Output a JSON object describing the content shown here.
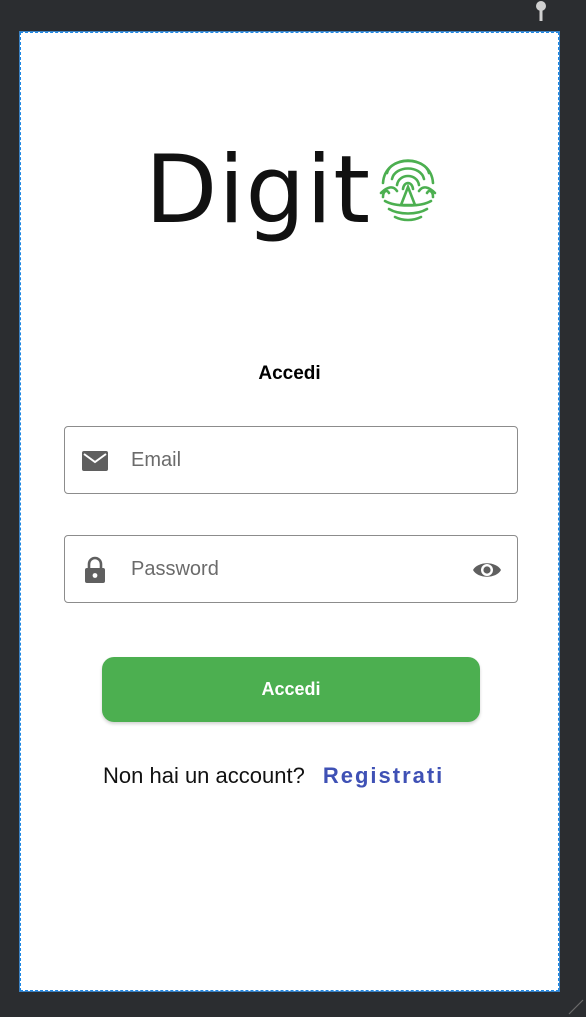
{
  "app": {
    "logo_text": "Digit"
  },
  "login": {
    "heading": "Accedi",
    "email": {
      "placeholder": "Email",
      "value": ""
    },
    "password": {
      "placeholder": "Password",
      "value": ""
    },
    "submit_label": "Accedi",
    "no_account_text": "Non hai un account?",
    "register_link": "Registrati"
  },
  "icons": {
    "email": "envelope-icon",
    "password": "lock-icon",
    "toggle_visibility": "eye-icon",
    "logo_mark": "fingerprint-icon",
    "editor_pin": "pin-icon"
  },
  "colors": {
    "accent": "#4caf50",
    "link": "#3f51b5",
    "background_frame": "#2b2d30",
    "field_border": "#8c8c8c"
  }
}
